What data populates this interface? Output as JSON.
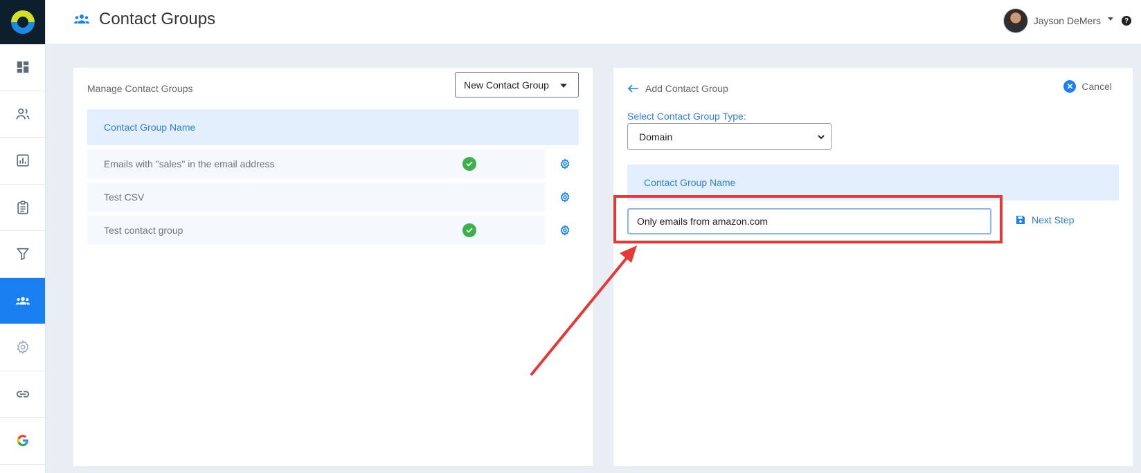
{
  "header": {
    "title": "Contact Groups",
    "user_name": "Jayson DeMers",
    "help_icon_glyph": "?"
  },
  "sidebar": {
    "items": [
      {
        "name": "dashboard-icon"
      },
      {
        "name": "contacts-icon"
      },
      {
        "name": "reports-icon"
      },
      {
        "name": "clipboard-icon"
      },
      {
        "name": "filter-icon"
      },
      {
        "name": "contact-groups-icon",
        "active": true
      },
      {
        "name": "gear-icon"
      },
      {
        "name": "link-icon"
      },
      {
        "name": "google-icon"
      }
    ]
  },
  "left_panel": {
    "heading": "Manage Contact Groups",
    "dropdown_label": "New Contact Group",
    "table_header": "Contact Group Name",
    "rows": [
      {
        "name": "Emails with \"sales\" in the email address",
        "active": true
      },
      {
        "name": "Test CSV",
        "active": false
      },
      {
        "name": "Test contact group",
        "active": true
      }
    ]
  },
  "right_panel": {
    "back_label": "Add Contact Group",
    "cancel_label": "Cancel",
    "type_label": "Select Contact Group Type:",
    "type_value": "Domain",
    "name_header": "Contact Group Name",
    "name_value": "Only emails from amazon.com",
    "next_step_label": "Next Step"
  },
  "colors": {
    "accent": "#1a7ff0",
    "highlight": "#e53935",
    "success": "#3cb04a"
  }
}
